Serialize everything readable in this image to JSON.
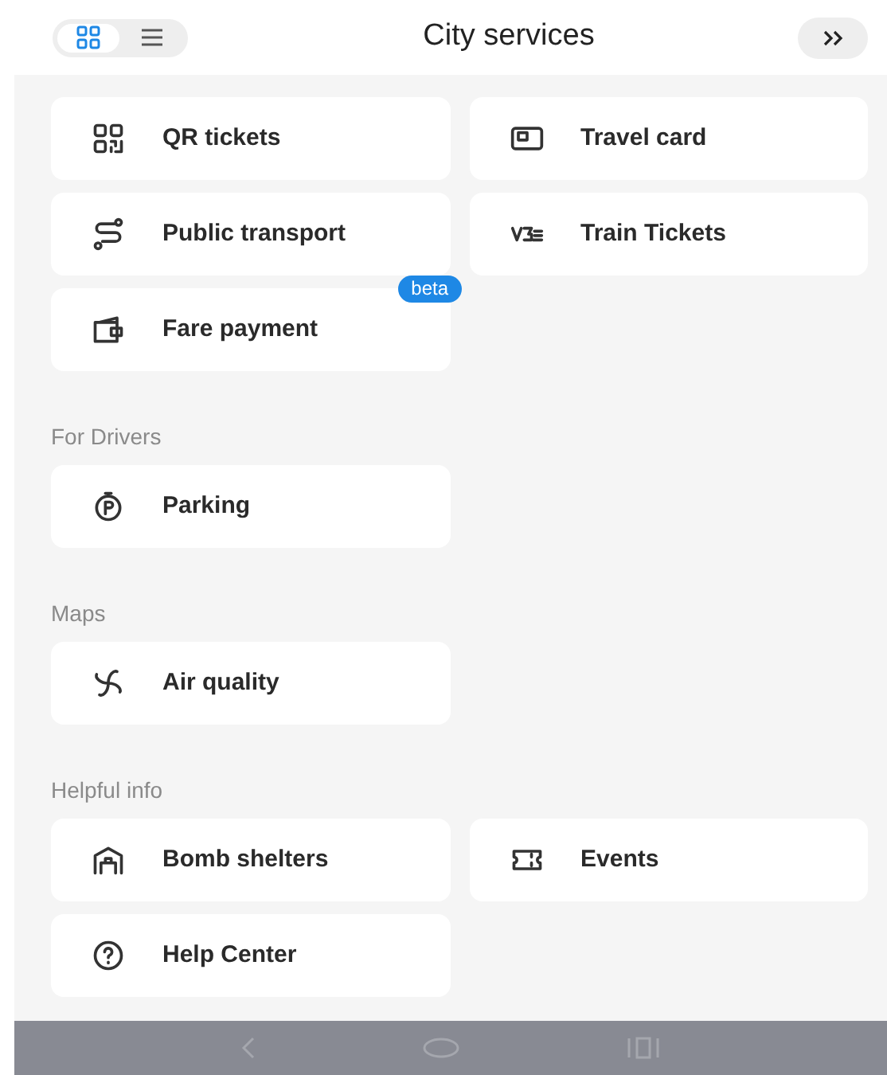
{
  "header": {
    "title": "City services",
    "view_toggle": [
      {
        "kind": "grid",
        "selected": true
      },
      {
        "kind": "list",
        "selected": false
      }
    ]
  },
  "sections": [
    {
      "items": [
        {
          "label": "QR tickets"
        },
        {
          "label": "Travel card"
        },
        {
          "label": "Public transport"
        },
        {
          "label": "Train Tickets"
        },
        {
          "label": "Fare payment",
          "badge": "beta"
        }
      ]
    },
    {
      "title": "For Drivers",
      "items": [
        {
          "label": "Parking"
        }
      ]
    },
    {
      "title": "Maps",
      "items": [
        {
          "label": "Air quality"
        }
      ]
    },
    {
      "title": "Helpful info",
      "items": [
        {
          "label": "Bomb shelters"
        },
        {
          "label": "Events"
        },
        {
          "label": "Help Center"
        }
      ]
    }
  ]
}
